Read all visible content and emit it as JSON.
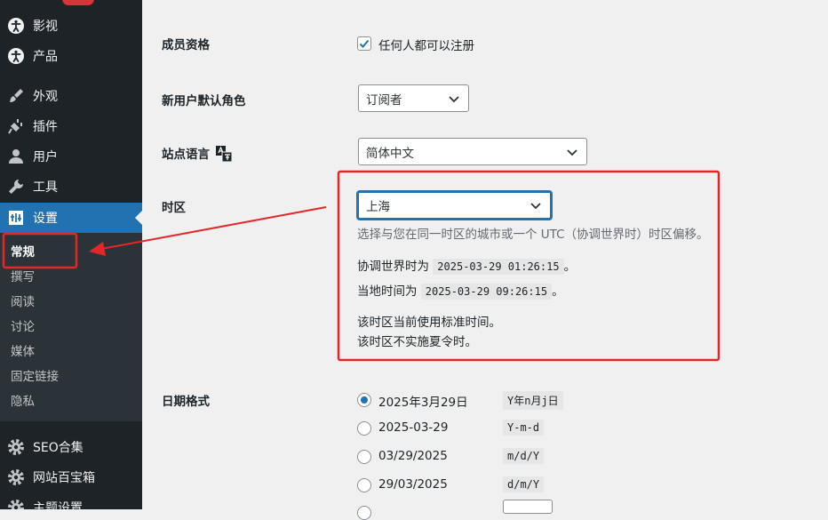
{
  "sidebar": {
    "top_items": [
      {
        "label": "影视",
        "icon": "accessibility-icon"
      },
      {
        "label": "产品",
        "icon": "accessibility-icon"
      },
      {
        "label": "外观",
        "icon": "paintbrush-icon"
      },
      {
        "label": "插件",
        "icon": "plugin-icon"
      },
      {
        "label": "用户",
        "icon": "user-icon"
      },
      {
        "label": "工具",
        "icon": "wrench-icon"
      },
      {
        "label": "设置",
        "icon": "settings-icon"
      }
    ],
    "submenu": [
      "常规",
      "撰写",
      "阅读",
      "讨论",
      "媒体",
      "固定链接",
      "隐私"
    ],
    "bottom_items": [
      {
        "label": "SEO合集",
        "icon": "gear-icon"
      },
      {
        "label": "网站百宝箱",
        "icon": "gear-icon"
      },
      {
        "label": "主题设置",
        "icon": "gear-icon"
      }
    ]
  },
  "settings": {
    "membership": {
      "label": "成员资格",
      "checkbox_label": "任何人都可以注册",
      "checked": true
    },
    "default_role": {
      "label": "新用户默认角色",
      "value": "订阅者"
    },
    "site_language": {
      "label": "站点语言",
      "value": "简体中文"
    },
    "timezone": {
      "label": "时区",
      "value": "上海",
      "description": "选择与您在同一时区的城市或一个 UTC（协调世界时）时区偏移。",
      "utc_prefix": "协调世界时为",
      "utc_time": "2025-03-29 01:26:15",
      "local_prefix": "当地时间为",
      "local_time": "2025-03-29 09:26:15",
      "suffix": "。",
      "note1": "该时区当前使用标准时间。",
      "note2": "该时区不实施夏令时。"
    },
    "date_format": {
      "label": "日期格式",
      "options": [
        {
          "display": "2025年3月29日",
          "code": "Y年n月j日",
          "checked": true
        },
        {
          "display": "2025-03-29",
          "code": "Y-m-d",
          "checked": false
        },
        {
          "display": "03/29/2025",
          "code": "m/d/Y",
          "checked": false
        },
        {
          "display": "29/03/2025",
          "code": "d/m/Y",
          "checked": false
        }
      ]
    }
  },
  "colors": {
    "accent": "#2271b1",
    "annotation": "#e3262a",
    "sidebar_bg": "#1d2327"
  }
}
